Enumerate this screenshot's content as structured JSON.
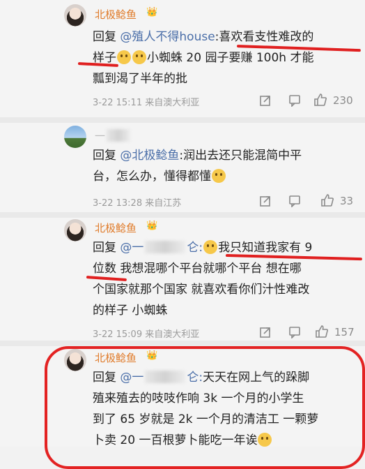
{
  "c1": {
    "name": "北极鲶鱼",
    "line1_a": "回复 ",
    "line1_mention": "@殖人不得house",
    "line1_b": ":喜欢看支性难改的",
    "line2_a": "样子",
    "line2_b": "小蜘蛛 20 园子要赚 100h 才能",
    "line3": "瓢到渴了半年的批",
    "meta": "3-22 15:11  来自澳大利亚",
    "likes": "230"
  },
  "c2": {
    "name": "一",
    "line1_a": "回复 ",
    "line1_mention": "@北极鲶鱼",
    "line1_b": ":润出去还只能混简中平",
    "line2": "台，怎么办，懂得都懂",
    "meta": "3-22 13:28  来自江苏",
    "likes": "33"
  },
  "c3": {
    "name": "北极鲶鱼",
    "line1_a": "回复 ",
    "line1_mention": "@一",
    "line1_mention2": "仑:",
    "line1_b": "我只知道我家有 9",
    "line2": "位数 我想混哪个平台就哪个平台 想在哪",
    "line3": "个国家就那个国家 就喜欢看你们汁性难改",
    "line4": "的样子 小蜘蛛",
    "meta": "3-22 15:09  来自澳大利亚",
    "likes": "157"
  },
  "c4": {
    "name": "北极鲶鱼",
    "line1_a": "回复 ",
    "line1_mention": "@一",
    "line1_mention2": "仑:",
    "line1_b": "天天在网上气的跺脚",
    "line2": "殖来殖去的吱吱作响 3k 一个月的小学生",
    "line3": "到了 65 岁就是 2k 一个月的清洁工 一颗萝",
    "line4": "卜卖 20 一百根萝卜能吃一年诶"
  },
  "icons": {
    "vip": "crown-badge-icon",
    "share": "share-icon",
    "comment": "comment-icon",
    "like": "thumbs-up-icon"
  },
  "colors": {
    "annotation_red": "#e02020",
    "username_orange": "#e07b2a",
    "mention_blue": "#4a6ea8"
  }
}
